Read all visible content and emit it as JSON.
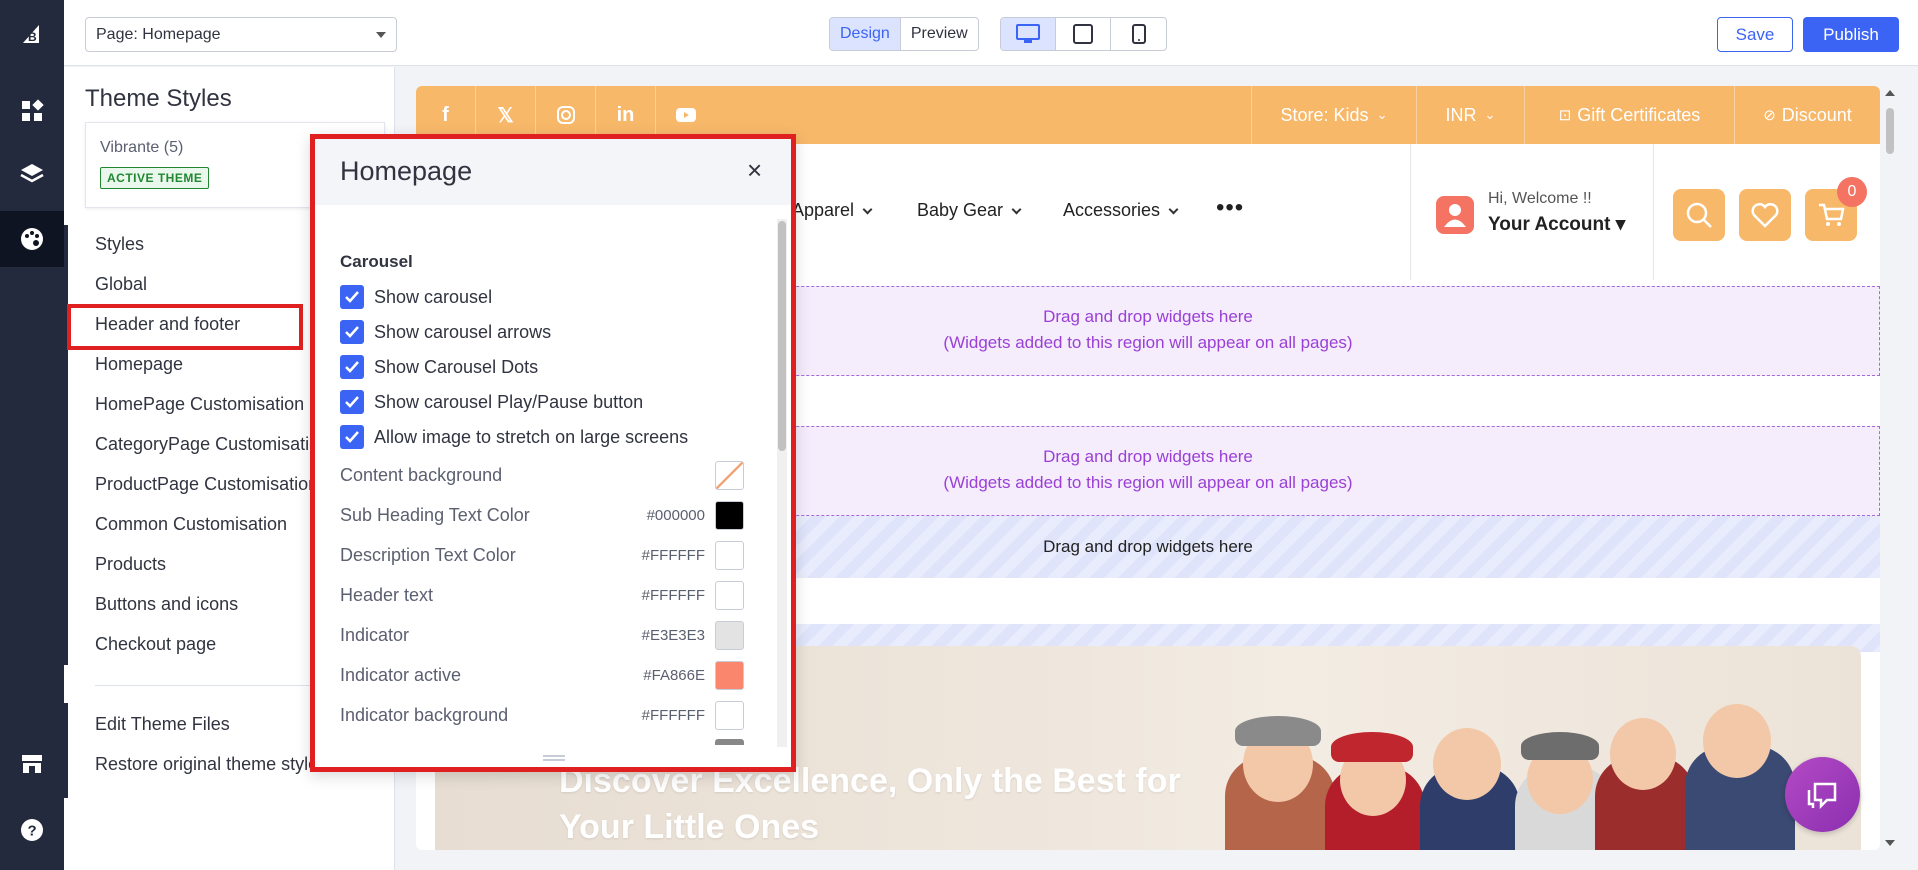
{
  "topbar": {
    "page_select": "Page: Homepage",
    "mode_design": "Design",
    "mode_preview": "Preview",
    "save_label": "Save",
    "publish_label": "Publish"
  },
  "sidebar": {
    "title": "Theme Styles",
    "theme_name": "Vibrante (5)",
    "theme_badge": "ACTIVE THEME",
    "items": [
      {
        "label": "Styles"
      },
      {
        "label": "Global"
      },
      {
        "label": "Header and footer"
      },
      {
        "label": "Homepage"
      },
      {
        "label": "HomePage Customisation"
      },
      {
        "label": "CategoryPage Customisation"
      },
      {
        "label": "ProductPage Customisation"
      },
      {
        "label": "Common Customisation"
      },
      {
        "label": "Products"
      },
      {
        "label": "Buttons and icons"
      },
      {
        "label": "Checkout page"
      }
    ],
    "footer_items": [
      {
        "label": "Edit Theme Files"
      },
      {
        "label": "Restore original theme styles"
      }
    ]
  },
  "preview": {
    "promo": {
      "store": "Store: Kids",
      "currency": "INR",
      "gift": "Gift Certificates",
      "discount": "Discount"
    },
    "menu": [
      "Apparel",
      "Baby Gear",
      "Accessories"
    ],
    "more": "•••",
    "welcome": "Hi, Welcome !!",
    "account": "Your Account ▾",
    "cart_count": "0",
    "drop_zone_text": "Drag and drop widgets here",
    "drop_zone_note": "(Widgets added to this region will appear on all pages)",
    "drop_simple": "Drag and drop widgets here",
    "hero_text": "Discover Excellence, Only the Best for Your Little Ones"
  },
  "panel": {
    "title": "Homepage",
    "close": "×",
    "section": "Carousel",
    "checkboxes": [
      {
        "label": "Show carousel",
        "checked": true
      },
      {
        "label": "Show carousel arrows",
        "checked": true
      },
      {
        "label": "Show Carousel Dots",
        "checked": true
      },
      {
        "label": "Show carousel Play/Pause button",
        "checked": true
      },
      {
        "label": "Allow image to stretch on large screens",
        "checked": true
      }
    ],
    "colors": [
      {
        "label": "Content background",
        "hex": "",
        "value": "transparent"
      },
      {
        "label": "Sub Heading Text Color",
        "hex": "#000000",
        "value": "#000000"
      },
      {
        "label": "Description Text Color",
        "hex": "#FFFFFF",
        "value": "#FFFFFF"
      },
      {
        "label": "Header text",
        "hex": "#FFFFFF",
        "value": "#FFFFFF"
      },
      {
        "label": "Indicator",
        "hex": "#E3E3E3",
        "value": "#E3E3E3"
      },
      {
        "label": "Indicator active",
        "hex": "#FA866E",
        "value": "#FA866E"
      },
      {
        "label": "Indicator background",
        "hex": "#FFFFFF",
        "value": "#FFFFFF"
      }
    ]
  },
  "colors": {
    "accent": "#3c64f4",
    "rail": "#232a3d",
    "promo": "#f8b86a",
    "highlight": "#e02020"
  }
}
